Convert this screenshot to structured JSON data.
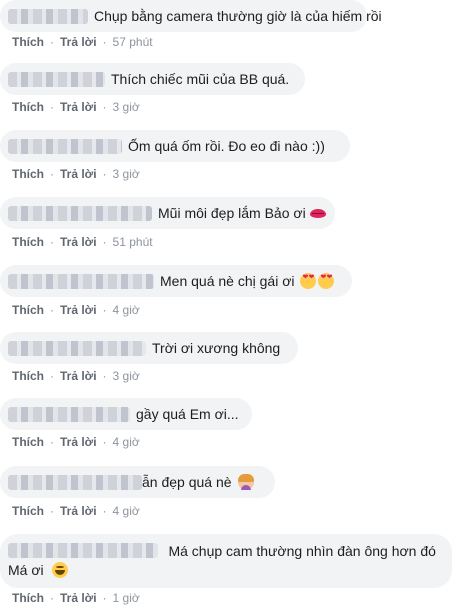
{
  "labels": {
    "like": "Thích",
    "reply": "Trả lời",
    "sep": "·"
  },
  "comments": [
    {
      "text": "Chụp bằng camera thường giờ là của hiếm rồi",
      "emoji": "",
      "time": "57 phút"
    },
    {
      "text": "Thích chiếc mũi của BB quá.",
      "emoji": "",
      "time": "3 giờ"
    },
    {
      "text": "Ốm quá ốm rồi. Đo eo đi nào :))",
      "emoji": "",
      "time": "3 giờ"
    },
    {
      "text": "Mũi môi đẹp lắm Bảo ơi",
      "emoji": "kiss-mark-icon",
      "time": "51 phút"
    },
    {
      "text": "Men quá nè chị gái ơi",
      "emoji": "heart-eyes-icon",
      "time": "4 giờ"
    },
    {
      "text": "Trời ơi xương không",
      "emoji": "",
      "time": "3 giờ"
    },
    {
      "text": "gầy quá Em ơi...",
      "emoji": "",
      "time": "4 giờ"
    },
    {
      "text": "ẫn đẹp quá nè",
      "emoji": "person-emoji-icon",
      "time": "4 giờ"
    },
    {
      "text": "Má chụp cam thường nhìn đàn ông hơn đó Má ơi",
      "emoji": "grin-icon",
      "time": "1 giờ"
    }
  ]
}
